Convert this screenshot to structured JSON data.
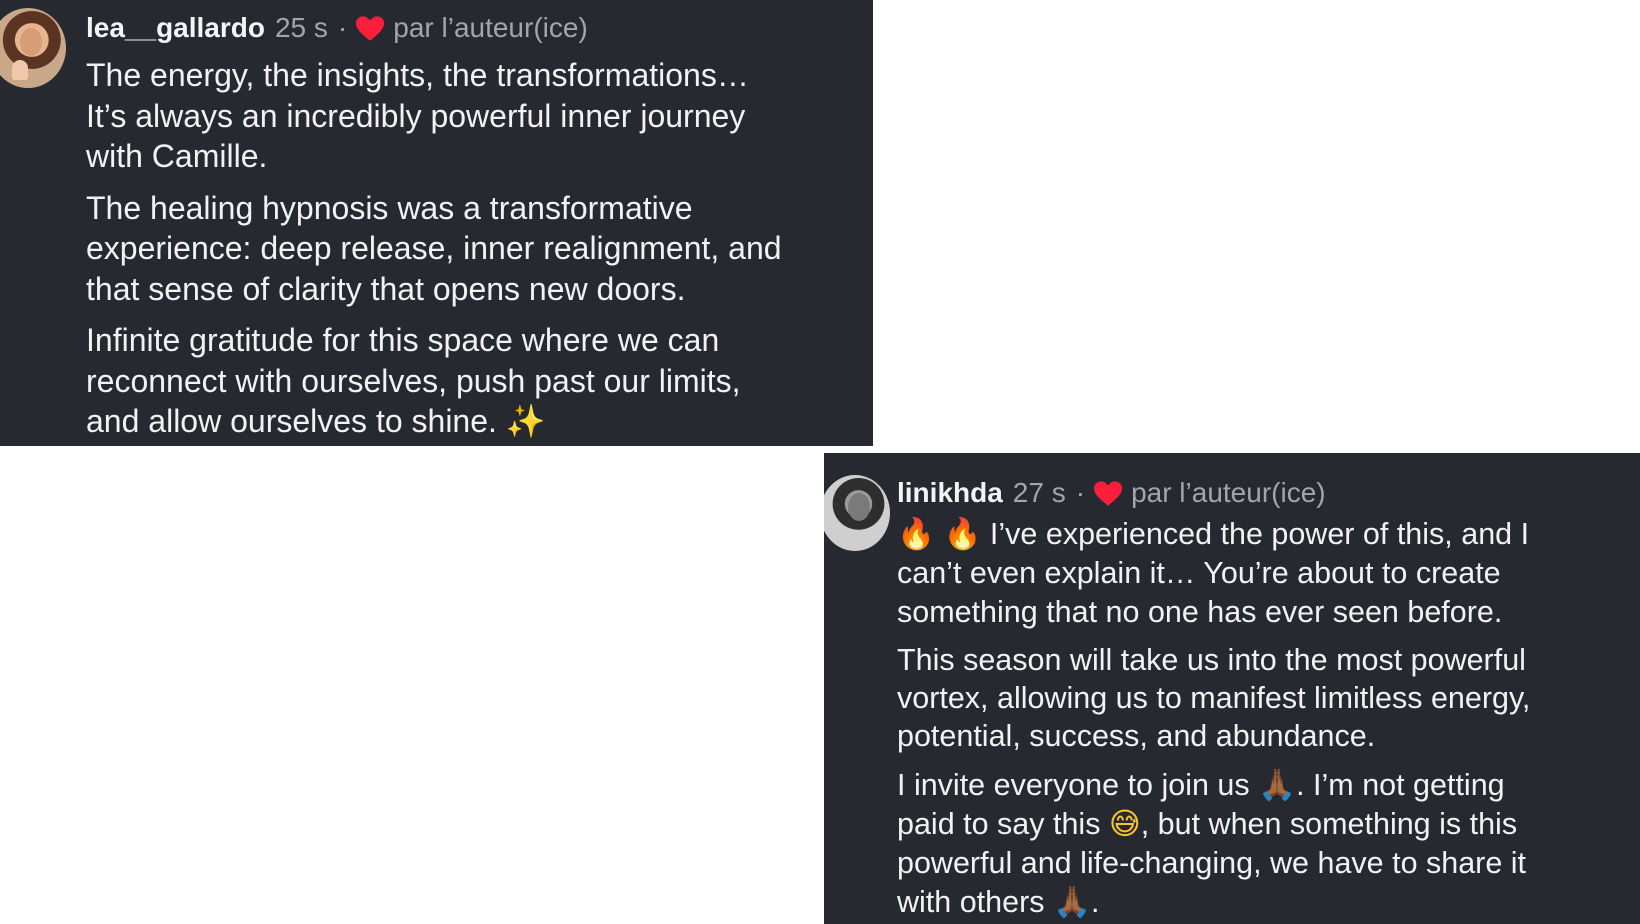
{
  "comments": [
    {
      "username": "lea__gallardo",
      "time": "25 s",
      "separator": "·",
      "liked_by": "par l’auteur(ice)",
      "lines_p1": [
        "The energy, the insights, the transformations…",
        "It’s always an incredibly powerful inner journey",
        "with Camille."
      ],
      "lines_p2": [
        "The healing hypnosis was a transformative",
        "experience: deep release, inner realignment, and",
        "that sense of clarity that opens new doors."
      ],
      "lines_p3": [
        "Infinite gratitude for this space where we can",
        "reconnect with ourselves, push past our limits,",
        "and allow ourselves to shine. "
      ],
      "emoji_sparkles": "✨"
    },
    {
      "username": "linikhda",
      "time": "27 s",
      "separator": "·",
      "liked_by": "par l’auteur(ice)",
      "emoji_fire": "🔥",
      "lines_p1": [
        " I’ve experienced the power of this, and I",
        "can’t even explain it… You’re about to create",
        "something that no one has ever seen before."
      ],
      "lines_p2": [
        "This season will take us into the most powerful",
        "vortex, allowing us to manifest limitless energy,",
        "potential, success, and abundance."
      ],
      "p3_a": "I invite everyone to join us ",
      "emoji_pray": "🙏🏾",
      "p3_b": ". I’m not getting",
      "p3_c": "paid to say this ",
      "emoji_grin": "😅",
      "p3_d": ", but when something is this",
      "p3_e": "powerful and life-changing, we have to share it",
      "p3_f": "with others ",
      "p3_g": "."
    }
  ],
  "colors": {
    "card_bg": "#262930",
    "text": "#f2f2f4",
    "muted": "#a4a5ab",
    "heart": "#ff1f3d"
  },
  "icons": [
    "avatar",
    "heart-icon",
    "sparkles-icon",
    "fire-icon",
    "pray-icon",
    "grin-icon"
  ]
}
